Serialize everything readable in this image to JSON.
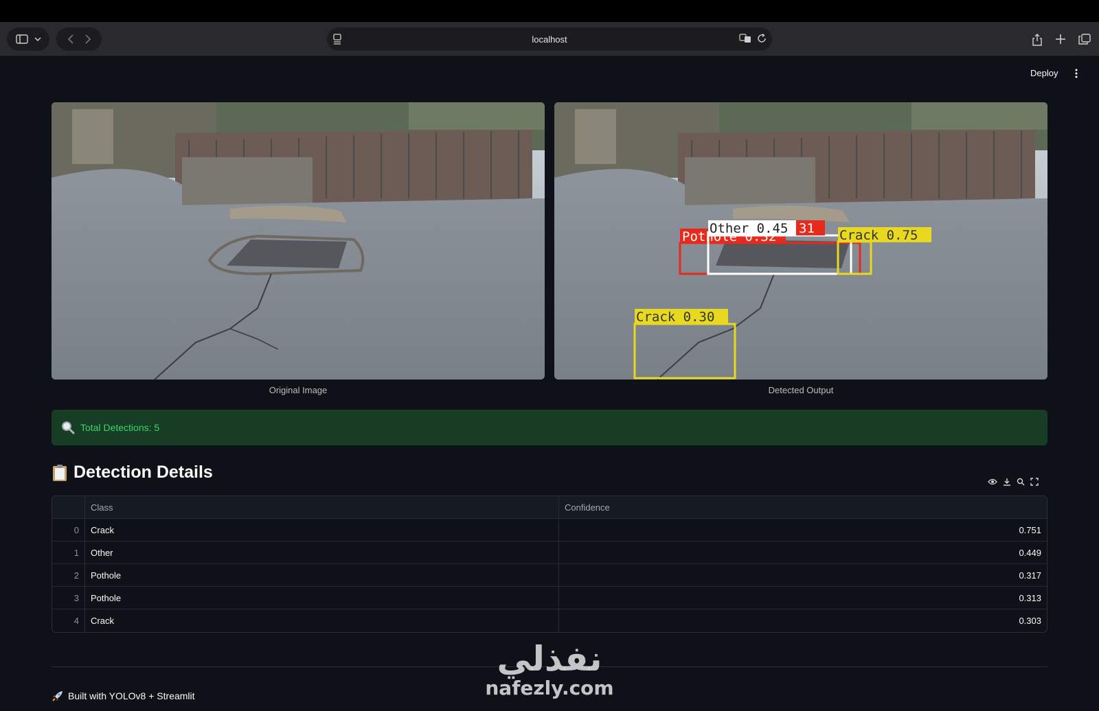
{
  "browser": {
    "url": "localhost"
  },
  "app": {
    "deploy_label": "Deploy"
  },
  "images": {
    "original_caption": "Original Image",
    "detected_caption": "Detected Output",
    "detections_overlay": [
      {
        "label": "Other 0.45"
      },
      {
        "label": "31"
      },
      {
        "label": "Pothole 0.32"
      },
      {
        "label": "Crack 0.75"
      },
      {
        "label": "Crack 0.30"
      }
    ]
  },
  "alert": {
    "text": "Total Detections: 5",
    "color": "#3dd56d"
  },
  "section": {
    "heading": "Detection Details"
  },
  "table": {
    "columns": [
      "Class",
      "Confidence"
    ],
    "rows": [
      {
        "index": "0",
        "class": "Crack",
        "confidence": "0.751"
      },
      {
        "index": "1",
        "class": "Other",
        "confidence": "0.449"
      },
      {
        "index": "2",
        "class": "Pothole",
        "confidence": "0.317"
      },
      {
        "index": "3",
        "class": "Pothole",
        "confidence": "0.313"
      },
      {
        "index": "4",
        "class": "Crack",
        "confidence": "0.303"
      }
    ]
  },
  "footer": {
    "text": "Built with YOLOv8 + Streamlit"
  },
  "watermark": {
    "arabic": "نفذلي",
    "latin": "nafezly.com"
  },
  "colors": {
    "background": "#0e1117",
    "crack_box": "#e8d820",
    "pothole_box": "#e82a1c",
    "other_box": "#ffffff"
  }
}
